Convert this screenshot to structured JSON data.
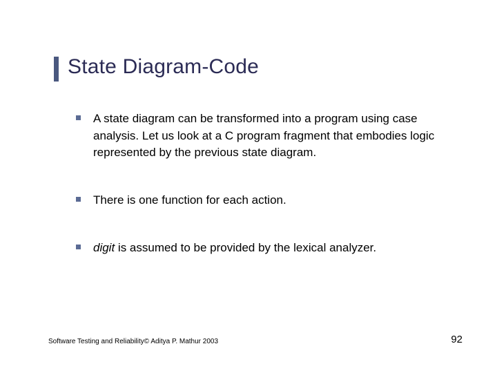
{
  "title": "State Diagram-Code",
  "bullets": {
    "b1": "A state diagram can be transformed into a program using case analysis. Let  us look at a C program fragment that embodies logic represented by the previous state diagram.",
    "b2": "There is one function for each action.",
    "b3_italic": "digit",
    "b3_rest": " is assumed to be provided by the lexical analyzer."
  },
  "footer": {
    "left": "Software Testing and Reliability© Aditya P. Mathur 2003",
    "page": "92"
  }
}
